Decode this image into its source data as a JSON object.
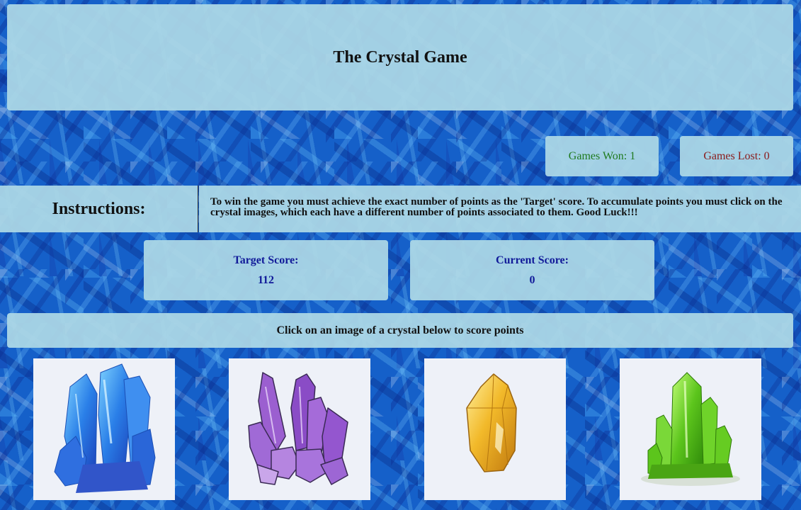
{
  "header": {
    "title": "The Crystal Game"
  },
  "stats": {
    "won_label": "Games Won: 1",
    "lost_label": "Games Lost: 0"
  },
  "instructions": {
    "title": "Instructions:",
    "text": "To win the game you must achieve the exact number of points as the 'Target' score. To accumulate points you must click on the crystal images, which each have a different number of points associated to them. Good Luck!!!"
  },
  "scores": {
    "target_label": "Target Score:",
    "target_value": "112",
    "current_label": "Current Score:",
    "current_value": "0"
  },
  "prompt": "Click on an image of a crystal below to score points",
  "crystals": [
    {
      "icon": "blue-crystal-icon",
      "color": "#2a7fe8"
    },
    {
      "icon": "purple-crystal-icon",
      "color": "#8e4fc2"
    },
    {
      "icon": "yellow-crystal-icon",
      "color": "#e3a51c"
    },
    {
      "icon": "green-crystal-icon",
      "color": "#5cc51c"
    }
  ],
  "colors": {
    "panel": "#add8e6",
    "won_text": "#1f7a1f",
    "lost_text": "#8b1a1a",
    "score_text": "#111a99",
    "background": "#1560c9"
  }
}
